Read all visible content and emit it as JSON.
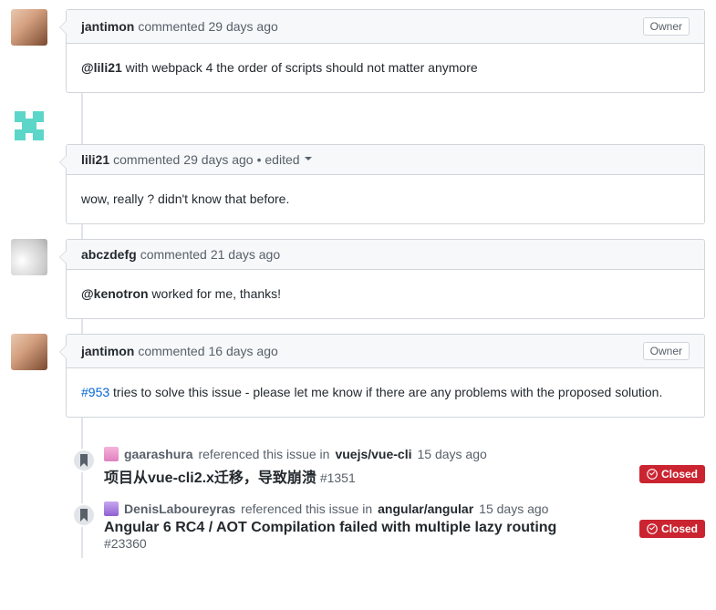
{
  "comments": [
    {
      "author": "jantimon",
      "action": "commented",
      "time": "29 days ago",
      "badge": "Owner",
      "body_mention": "@lili21",
      "body_text": " with webpack 4 the order of scripts should not matter anymore",
      "edited": null,
      "link": null
    },
    {
      "author": "lili21",
      "action": "commented",
      "time": "29 days ago",
      "badge": null,
      "edited": "• edited",
      "body_mention": null,
      "body_text": "wow, really ? didn't know that before.",
      "link": null
    },
    {
      "author": "abczdefg",
      "action": "commented",
      "time": "21 days ago",
      "badge": null,
      "edited": null,
      "body_mention": "@kenotron",
      "body_text": " worked for me, thanks!",
      "link": null
    },
    {
      "author": "jantimon",
      "action": "commented",
      "time": "16 days ago",
      "badge": "Owner",
      "edited": null,
      "body_mention": null,
      "body_text": " tries to solve this issue - please let me know if there are any problems with the proposed solution.",
      "link": "#953"
    }
  ],
  "refs": [
    {
      "author": "gaarashura",
      "action": "referenced this issue in",
      "repo": "vuejs/vue-cli",
      "time": "15 days ago",
      "title": "项目从vue-cli2.x迁移，导致崩溃",
      "number": "#1351",
      "state": "Closed"
    },
    {
      "author": "DenisLaboureyras",
      "action": "referenced this issue in",
      "repo": "angular/angular",
      "time": "15 days ago",
      "title": "Angular 6 RC4 / AOT Compilation failed with multiple lazy routing",
      "number": "#23360",
      "state": "Closed"
    }
  ]
}
